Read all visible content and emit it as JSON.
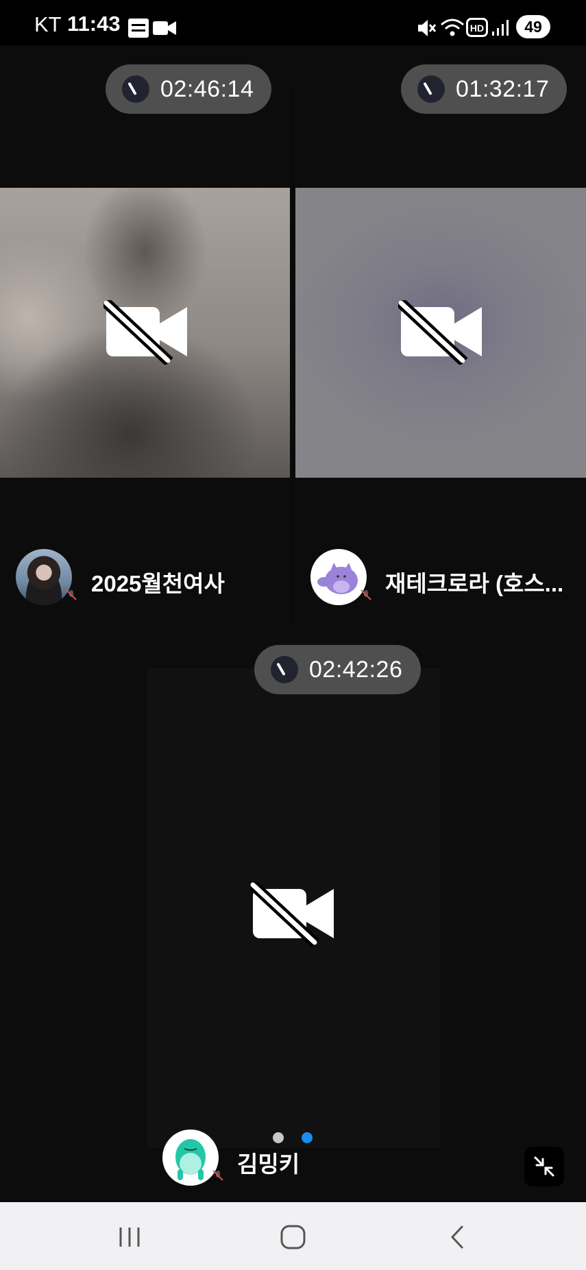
{
  "status_bar": {
    "carrier": "KT",
    "time": "11:43",
    "battery": "49"
  },
  "participants": [
    {
      "name": "2025월천여사",
      "timer": "02:46:14"
    },
    {
      "name": "재테크로라 (호스...",
      "timer": "01:32:17"
    },
    {
      "name": "김밍키",
      "timer": "02:42:26"
    }
  ],
  "pager": {
    "total": 2,
    "active": 2
  },
  "colors": {
    "pill": "#4f4f4f",
    "page_dot_active": "#1a8cf0",
    "page_dot_inactive": "#c8c8cc"
  },
  "icons": [
    "clock-icon",
    "video-off-icon",
    "mic-off-icon",
    "minimize-icon",
    "recent-apps-icon",
    "home-icon",
    "back-icon"
  ]
}
